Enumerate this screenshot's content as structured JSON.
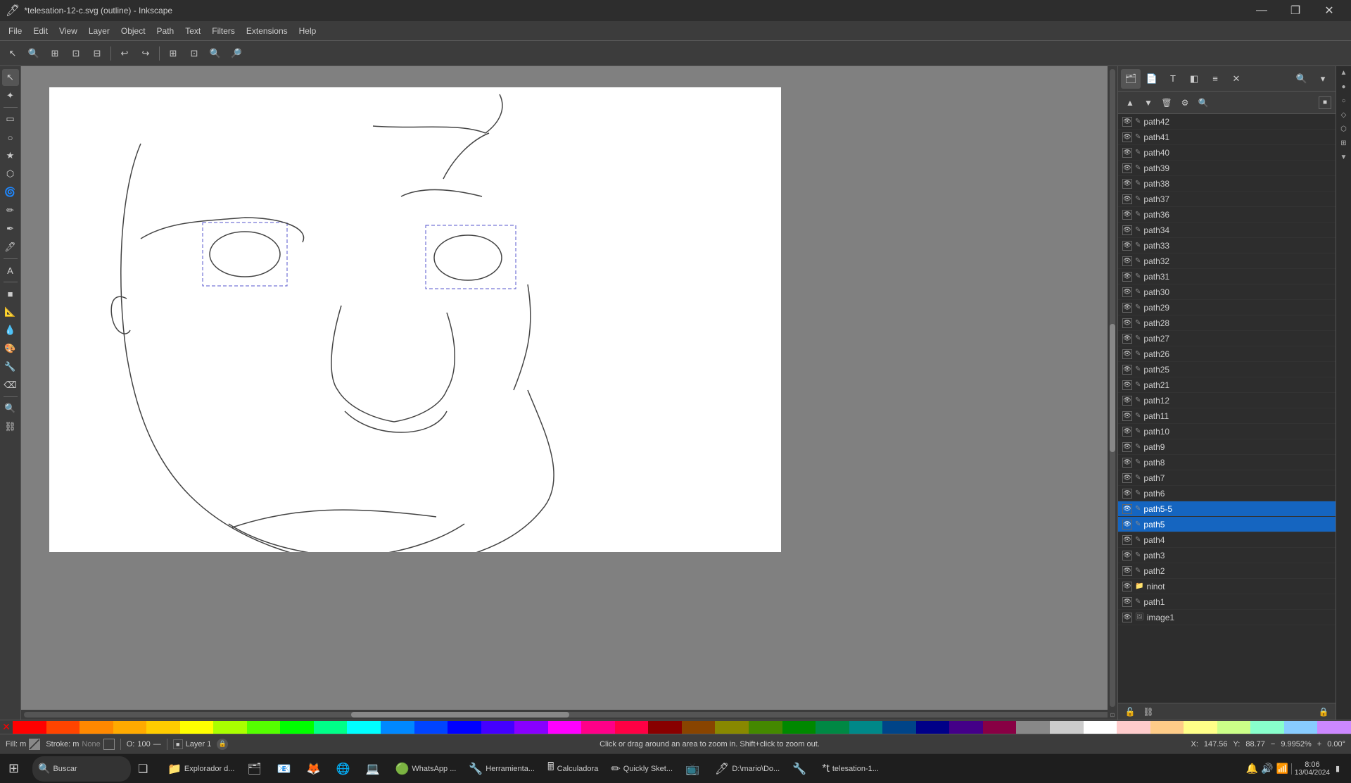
{
  "titlebar": {
    "title": "*telesation-12-c.svg (outline) - Inkscape",
    "min": "—",
    "max": "❐",
    "close": "✕"
  },
  "menubar": {
    "items": [
      "File",
      "Edit",
      "View",
      "Layer",
      "Object",
      "Path",
      "Text",
      "Filters",
      "Extensions",
      "Help"
    ]
  },
  "toolbar": {
    "buttons": [
      "🔍",
      "🔎",
      "⊕",
      "⊖",
      "↩",
      "↪",
      "⊞",
      "⊡",
      "⊟",
      "🔍",
      "🔍"
    ]
  },
  "tools": {
    "items": [
      "↖",
      "↔",
      "✎",
      "◻",
      "◯",
      "⭐",
      "✏",
      "✒",
      "🖊",
      "A",
      "⊞",
      "🖼",
      "🎨",
      "💧",
      "✂",
      "📐",
      "🔧",
      "🌊",
      "📝",
      "🔍",
      "🔧"
    ]
  },
  "layers": {
    "items": [
      {
        "name": "path42",
        "selected": false
      },
      {
        "name": "path41",
        "selected": false
      },
      {
        "name": "path40",
        "selected": false
      },
      {
        "name": "path39",
        "selected": false
      },
      {
        "name": "path38",
        "selected": false
      },
      {
        "name": "path37",
        "selected": false
      },
      {
        "name": "path36",
        "selected": false
      },
      {
        "name": "path34",
        "selected": false
      },
      {
        "name": "path33",
        "selected": false
      },
      {
        "name": "path32",
        "selected": false
      },
      {
        "name": "path31",
        "selected": false
      },
      {
        "name": "path30",
        "selected": false
      },
      {
        "name": "path29",
        "selected": false
      },
      {
        "name": "path28",
        "selected": false
      },
      {
        "name": "path27",
        "selected": false
      },
      {
        "name": "path26",
        "selected": false
      },
      {
        "name": "path25",
        "selected": false
      },
      {
        "name": "path21",
        "selected": false
      },
      {
        "name": "path12",
        "selected": false
      },
      {
        "name": "path11",
        "selected": false
      },
      {
        "name": "path10",
        "selected": false
      },
      {
        "name": "path9",
        "selected": false
      },
      {
        "name": "path8",
        "selected": false
      },
      {
        "name": "path7",
        "selected": false
      },
      {
        "name": "path6",
        "selected": false
      },
      {
        "name": "path5-5",
        "selected": true
      },
      {
        "name": "path5",
        "selected": true
      },
      {
        "name": "path4",
        "selected": false
      },
      {
        "name": "path3",
        "selected": false
      },
      {
        "name": "path2",
        "selected": false
      },
      {
        "name": "ninot",
        "selected": false
      },
      {
        "name": "path1",
        "selected": false
      },
      {
        "name": "image1",
        "selected": false
      }
    ]
  },
  "statusbar": {
    "fill_label": "Fill: m",
    "stroke_label": "Stroke: m",
    "stroke_val": "None",
    "opacity": "O:",
    "opacity_val": "100",
    "layer_label": "Layer 1",
    "status_msg": "Click or drag around an area to zoom in. Shift+click to zoom out.",
    "x_label": "X:",
    "x_val": "147.56",
    "y_label": "Y:",
    "y_val": "88.77",
    "zoom_val": "9.9952%",
    "rotation_val": "0.00°"
  },
  "palette": {
    "colors": [
      "#ff0000",
      "#ff4400",
      "#ff8800",
      "#ffaa00",
      "#ffcc00",
      "#ffff00",
      "#aaff00",
      "#55ff00",
      "#00ff00",
      "#00ff88",
      "#00ffff",
      "#0088ff",
      "#0044ff",
      "#0000ff",
      "#4400ff",
      "#8800ff",
      "#ff00ff",
      "#ff0088",
      "#ff0044",
      "#880000",
      "#884400",
      "#888800",
      "#448800",
      "#008800",
      "#008844",
      "#008888",
      "#004488",
      "#000088",
      "#440088",
      "#880044",
      "#888888",
      "#cccccc",
      "#ffffff",
      "#ffcccc",
      "#ffcc88",
      "#ffff88",
      "#ccff88",
      "#88ffcc",
      "#88ccff",
      "#cc88ff"
    ]
  },
  "taskbar": {
    "start_icon": "⊞",
    "search_label": "Buscar",
    "apps": [
      {
        "icon": "📁",
        "label": "Explorador d..."
      },
      {
        "icon": "🗂",
        "label": ""
      },
      {
        "icon": "📧",
        "label": ""
      },
      {
        "icon": "🦊",
        "label": ""
      },
      {
        "icon": "🌐",
        "label": ""
      },
      {
        "icon": "💻",
        "label": ""
      },
      {
        "icon": "🟢",
        "label": "WhatsApp ..."
      },
      {
        "icon": "🔧",
        "label": "Herramienta..."
      },
      {
        "icon": "🖩",
        "label": "Calculadora"
      },
      {
        "icon": "✏",
        "label": "Quickly Sket..."
      },
      {
        "icon": "📺",
        "label": ""
      },
      {
        "icon": "🖊",
        "label": "D:\\mario\\Do..."
      },
      {
        "icon": "🔧",
        "label": ""
      },
      {
        "icon": "*t",
        "label": "telesation-1..."
      }
    ],
    "clock": "8:06",
    "date": "13/04/2024"
  },
  "panel_tabs": {
    "buttons": [
      "📁",
      "📄",
      "T",
      "✏",
      "≡",
      "🔍"
    ]
  }
}
